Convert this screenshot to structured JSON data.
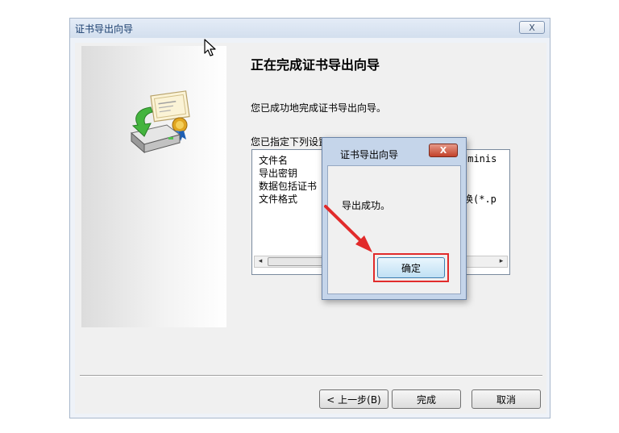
{
  "window": {
    "title": "证书导出向导",
    "close_label": "X"
  },
  "wizard": {
    "heading": "正在完成证书导出向导",
    "description": "您已成功地完成证书导出向导。",
    "settings_label": "您已指定下列设置",
    "rows": [
      {
        "name": "文件名",
        "value": "dminis"
      },
      {
        "name": "导出密钥",
        "value": ""
      },
      {
        "name": "数据包括证书",
        "value": ""
      },
      {
        "name": "文件格式",
        "value": "换(*.p"
      }
    ],
    "scroll_left": "◂",
    "scroll_right": "▸"
  },
  "buttons": {
    "back": "< 上一步(B)",
    "finish": "完成",
    "cancel": "取消"
  },
  "dialog": {
    "title": "证书导出向导",
    "close_label": "X",
    "message": "导出成功。",
    "ok_label": "确定"
  },
  "colors": {
    "highlight_red": "#e12b2b",
    "dialog_frame": "#c5d5ea",
    "close_red": "#c2412a"
  },
  "icons": [
    "certificate-export-icon",
    "mouse-cursor-icon",
    "annotation-arrow-icon"
  ]
}
